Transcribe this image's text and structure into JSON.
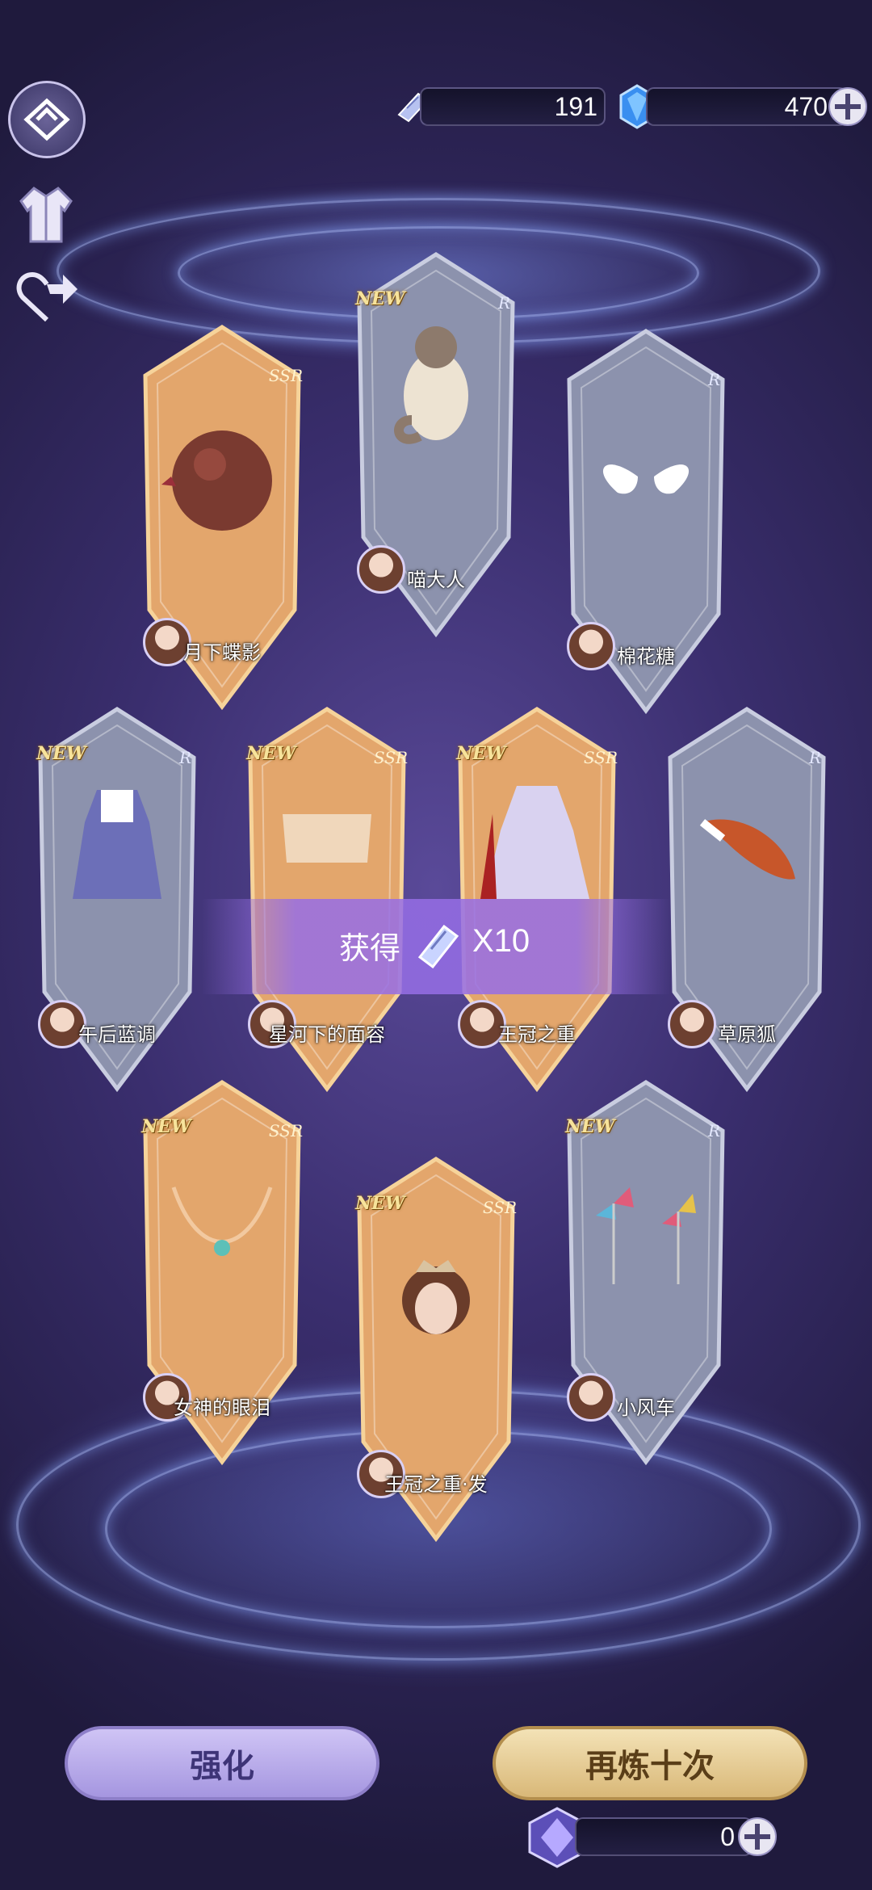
{
  "header": {
    "ticket_count": "191",
    "crystal_count": "470"
  },
  "cards": [
    {
      "id": "c1",
      "name": "月下蝶影",
      "rarity": "SSR",
      "is_new": false,
      "new_label": "",
      "frame": "gold",
      "item_icon": "orb-butterfly-icon"
    },
    {
      "id": "c2",
      "name": "喵大人",
      "rarity": "R",
      "is_new": true,
      "new_label": "NEW",
      "frame": "silver",
      "item_icon": "raccoon-cat-icon"
    },
    {
      "id": "c3",
      "name": "棉花糖",
      "rarity": "R",
      "is_new": false,
      "new_label": "",
      "frame": "silver",
      "item_icon": "angel-wings-icon"
    },
    {
      "id": "c4",
      "name": "午后蓝调",
      "rarity": "R",
      "is_new": true,
      "new_label": "NEW",
      "frame": "silver",
      "item_icon": "blue-dress-icon"
    },
    {
      "id": "c5",
      "name": "星河下的面容",
      "rarity": "SSR",
      "is_new": true,
      "new_label": "NEW",
      "frame": "gold",
      "item_icon": "veil-icon"
    },
    {
      "id": "c6",
      "name": "王冠之重",
      "rarity": "SSR",
      "is_new": true,
      "new_label": "NEW",
      "frame": "gold",
      "item_icon": "royal-gown-icon"
    },
    {
      "id": "c7",
      "name": "草原狐",
      "rarity": "R",
      "is_new": false,
      "new_label": "",
      "frame": "silver",
      "item_icon": "fox-tail-icon"
    },
    {
      "id": "c8",
      "name": "女神的眼泪",
      "rarity": "SSR",
      "is_new": true,
      "new_label": "NEW",
      "frame": "gold",
      "item_icon": "necklace-icon"
    },
    {
      "id": "c9",
      "name": "王冠之重·发",
      "rarity": "SSR",
      "is_new": true,
      "new_label": "NEW",
      "frame": "gold",
      "item_icon": "tiara-hair-icon"
    },
    {
      "id": "c10",
      "name": "小风车",
      "rarity": "R",
      "is_new": true,
      "new_label": "NEW",
      "frame": "silver",
      "item_icon": "pinwheel-icon"
    }
  ],
  "rarity_labels": {
    "SSR": "SSR",
    "R": "R"
  },
  "reward_banner": {
    "label": "获得",
    "amount": "X10"
  },
  "footer": {
    "enhance_label": "强化",
    "redraw_label": "再炼十次",
    "cost_count": "0"
  },
  "colors": {
    "gold_frame": "#e3a66c",
    "silver_frame": "#8c92ad",
    "accent_purple": "#a88be6",
    "redraw_gold": "#d9b878"
  }
}
